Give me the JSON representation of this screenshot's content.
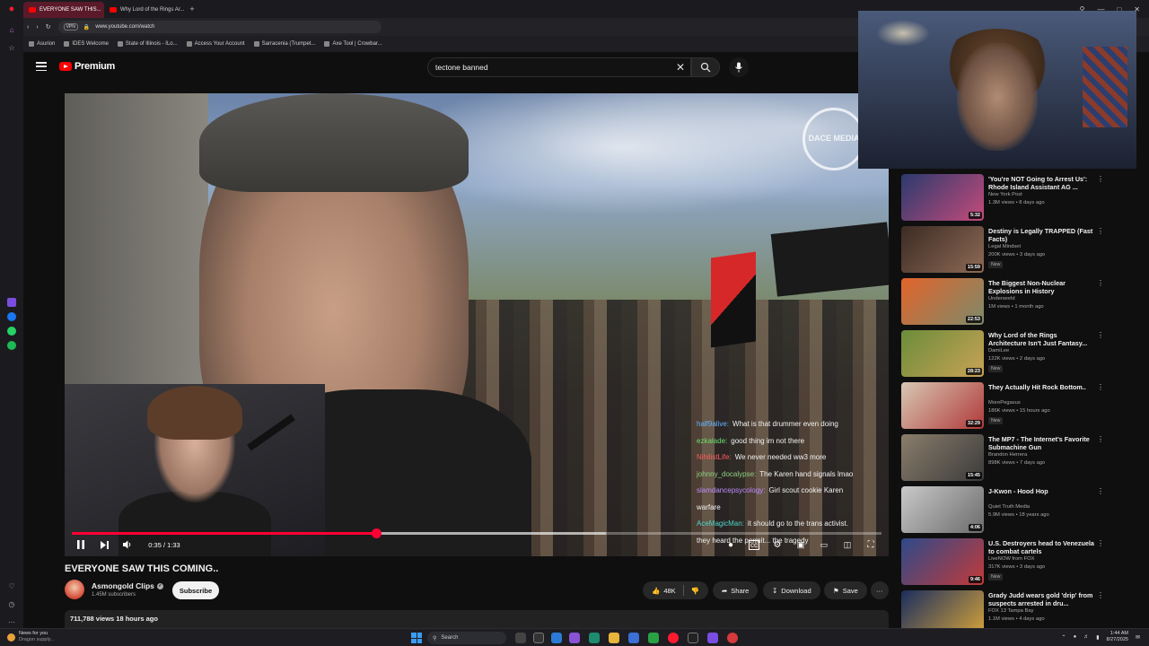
{
  "browser": {
    "tabs": [
      {
        "label": "EVERYONE SAW THIS...",
        "active": true
      },
      {
        "label": "Why Lord of the Rings Ar...",
        "active": false
      }
    ],
    "new_tab": "+",
    "url": "www.youtube.com/watch",
    "vpn": "VPN",
    "bookmarks": [
      "Asurion",
      "IDES Welcome",
      "State of Illinois - ILo...",
      "Access Your Account",
      "Sarracenia (Trumpet...",
      "Axe Tool | Crowbar..."
    ]
  },
  "youtube": {
    "logo_text": "Premium",
    "search": {
      "value": "tectone banned"
    },
    "player": {
      "current_time": "0:35",
      "duration": "1:33",
      "time_display": "0:35 / 1:33",
      "progress_fraction": 0.376,
      "buffer_fraction": 0.66,
      "watermark": "DACE MEDIA"
    },
    "chat": [
      {
        "user": "half9alive:",
        "message": "What is that drummer even doing",
        "color": "#63b3ff"
      },
      {
        "user": "ezkalade:",
        "message": "good thing im not there",
        "color": "#6de06d"
      },
      {
        "user": "NihilistLife:",
        "message": "We never needed ww3 more",
        "color": "#ff5c5c"
      },
      {
        "user": "johnny_docalypse:",
        "message": "The Karen hand signals lmao",
        "color": "#8fd17f"
      },
      {
        "user": "slamdancepsycology:",
        "message": "Girl scout cookie Karen",
        "color": "#c08cff"
      },
      {
        "user": "",
        "message": "warfare",
        "color": "#ffffff"
      },
      {
        "user": "AceMagicMan:",
        "message": "it should go to the trans activist.",
        "color": "#4fd6c8"
      },
      {
        "user": "",
        "message": "they heard the permit... the tragedy",
        "color": "#ffffff"
      }
    ],
    "video": {
      "title": "EVERYONE SAW THIS COMING..",
      "channel": "Asmongold Clips",
      "subscribers": "1.45M subscribers",
      "subscribe_label": "Subscribe",
      "likes": "48K",
      "share_label": "Share",
      "download_label": "Download",
      "save_label": "Save",
      "more_label": "···",
      "views_date": "711,788 views  18 hours ago"
    },
    "recommendations": [
      {
        "title": "'You're NOT Going to Arrest Us': Rhode Island Assistant AG ...",
        "channel": "New York Post",
        "meta": "1.3M views • 8 days ago",
        "duration": "5:32",
        "badge": "",
        "colors": [
          "#2b3a6e",
          "#c44b7a"
        ]
      },
      {
        "title": "Destiny is Legally TRAPPED (Fast Facts)",
        "channel": "Legal Mindset",
        "meta": "200K views • 3 days ago",
        "duration": "15:59",
        "badge": "New",
        "colors": [
          "#3c2b24",
          "#8d6a55"
        ]
      },
      {
        "title": "The Biggest Non-Nuclear Explosions in History",
        "channel": "Underworld",
        "meta": "1M views • 1 month ago",
        "duration": "22:53",
        "badge": "",
        "colors": [
          "#e2642a",
          "#7d8a6b"
        ]
      },
      {
        "title": "Why Lord of the Rings Architecture Isn't Just Fantasy...",
        "channel": "DamiLee",
        "meta": "122K views • 2 days ago",
        "duration": "28:23",
        "badge": "New",
        "colors": [
          "#6b8d3a",
          "#c9a255"
        ]
      },
      {
        "title": "They Actually Hit Rock Bottom..",
        "channel": "MorePegasus",
        "meta": "186K views • 15 hours ago",
        "duration": "32:29",
        "badge": "New",
        "colors": [
          "#d8c7b3",
          "#b03a3a"
        ]
      },
      {
        "title": "The MP7 - The Internet's Favorite Submachine Gun",
        "channel": "Brandon Herrera",
        "meta": "898K views • 7 days ago",
        "duration": "15:45",
        "badge": "",
        "colors": [
          "#8a7d6b",
          "#3b3b3b"
        ]
      },
      {
        "title": "J-Kwon - Hood Hop",
        "channel": "Quiet Truth Media",
        "meta": "5.9M views • 18 years ago",
        "duration": "4:06",
        "badge": "",
        "colors": [
          "#c9c9c9",
          "#6b6b6b"
        ]
      },
      {
        "title": "U.S. Destroyers head to Venezuela to combat cartels",
        "channel": "LiveNOW from FOX",
        "meta": "317K views • 3 days ago",
        "duration": "9:46",
        "badge": "New",
        "colors": [
          "#2d4a8a",
          "#c23a3a"
        ]
      },
      {
        "title": "Grady Judd wears gold 'drip' from suspects arrested in dru...",
        "channel": "FOX 13 Tampa Bay",
        "meta": "1.1M views • 4 days ago",
        "duration": "",
        "badge": "",
        "colors": [
          "#1b2d5e",
          "#d6a43a"
        ]
      }
    ]
  },
  "taskbar": {
    "weather_title": "News for you",
    "weather_sub": "Dragon supply...",
    "search_placeholder": "Search",
    "time": "1:44 AM",
    "date": "8/27/2025"
  }
}
